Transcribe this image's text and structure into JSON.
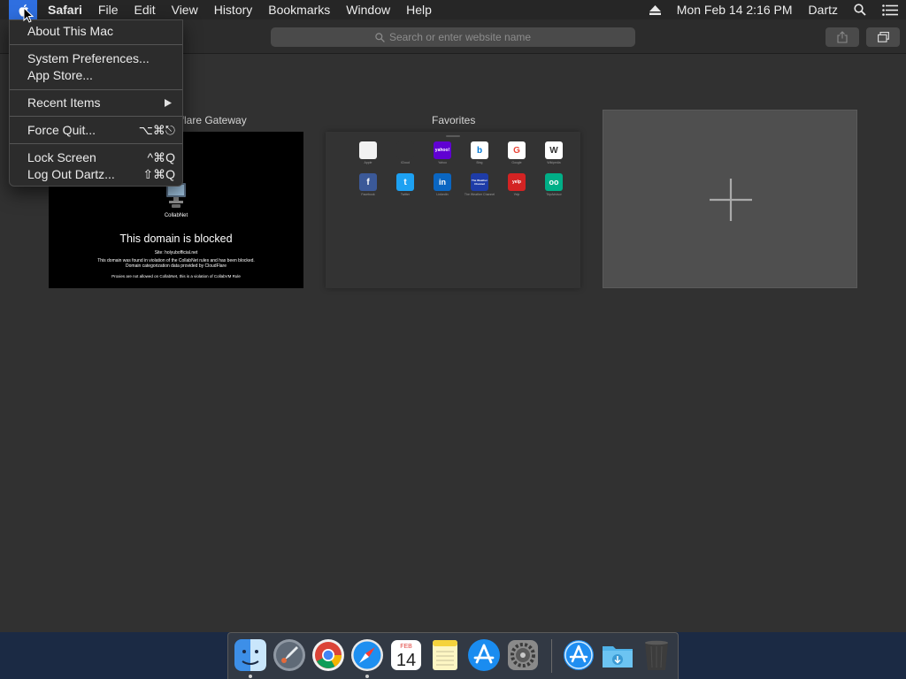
{
  "menubar": {
    "app_name": "Safari",
    "items": [
      "File",
      "Edit",
      "View",
      "History",
      "Bookmarks",
      "Window",
      "Help"
    ],
    "clock": "Mon Feb 14  2:16 PM",
    "user": "Dartz"
  },
  "toolbar": {
    "address_placeholder": "Search or enter website name"
  },
  "apple_menu": {
    "about": "About This Mac",
    "system_prefs": "System Preferences...",
    "app_store": "App Store...",
    "recent_items": "Recent Items",
    "force_quit": "Force Quit...",
    "force_quit_shortcut": "⌥⌘⎋",
    "lock_screen": "Lock Screen",
    "lock_screen_shortcut": "^⌘Q",
    "log_out": "Log Out Dartz...",
    "log_out_shortcut": "⇧⌘Q"
  },
  "tiles": {
    "gateway": {
      "title_visible": "lflare Gateway",
      "collabnet": "CollabNet",
      "heading": "This domain is blocked",
      "site": "Site: holyubofficial.net",
      "description": "This domain was found in violation of the CollabNet rules and has been blocked. Domain categorization data provided by CloudFlare",
      "footer": "Proxies are not allowed on CollabNet, this is a violation of CollabVM Rule"
    },
    "favorites": {
      "title": "Favorites",
      "items": [
        {
          "label": "Apple",
          "icon": "apple-icon",
          "bg": "#f2f2f2",
          "fg": "#555555",
          "glyph": ""
        },
        {
          "label": "iCloud",
          "icon": "apple-icon",
          "bg": "#333333",
          "fg": "#9a9a9a",
          "glyph": ""
        },
        {
          "label": "Yahoo",
          "icon": "yahoo-icon",
          "bg": "#6001d2",
          "fg": "#ffffff",
          "glyph": "yahoo!"
        },
        {
          "label": "Bing",
          "icon": "bing-icon",
          "bg": "#ffffff",
          "fg": "#0078d4",
          "glyph": "b"
        },
        {
          "label": "Google",
          "icon": "google-icon",
          "bg": "#ffffff",
          "fg": "#ea4335",
          "glyph": "G"
        },
        {
          "label": "Wikipedia",
          "icon": "wikipedia-icon",
          "bg": "#ffffff",
          "fg": "#333333",
          "glyph": "W"
        },
        {
          "label": "Facebook",
          "icon": "facebook-icon",
          "bg": "#3b5998",
          "fg": "#ffffff",
          "glyph": "f"
        },
        {
          "label": "Twitter",
          "icon": "twitter-icon",
          "bg": "#1da1f2",
          "fg": "#ffffff",
          "glyph": "t"
        },
        {
          "label": "LinkedIn",
          "icon": "linkedin-icon",
          "bg": "#0a66c2",
          "fg": "#ffffff",
          "glyph": "in"
        },
        {
          "label": "The Weather Channel",
          "icon": "weather-channel-icon",
          "bg": "#1e3ca8",
          "fg": "#ffffff",
          "glyph": "The Weather Channel"
        },
        {
          "label": "Yelp",
          "icon": "yelp-icon",
          "bg": "#d32323",
          "fg": "#ffffff",
          "glyph": "yelp"
        },
        {
          "label": "TripAdvisor",
          "icon": "tripadvisor-icon",
          "bg": "#00af87",
          "fg": "#ffffff",
          "glyph": "oo"
        }
      ]
    }
  },
  "dock": {
    "apps": [
      {
        "name": "finder",
        "running": true
      },
      {
        "name": "launchpad",
        "running": false
      },
      {
        "name": "chrome",
        "running": false
      },
      {
        "name": "safari",
        "running": true
      },
      {
        "name": "calendar",
        "running": false,
        "month": "FEB",
        "day": "14"
      },
      {
        "name": "notes",
        "running": false
      },
      {
        "name": "app-store",
        "running": false
      },
      {
        "name": "system-preferences",
        "running": false
      },
      {
        "name": "applications-folder",
        "running": false
      },
      {
        "name": "downloads-folder",
        "running": false
      },
      {
        "name": "trash",
        "running": false
      }
    ]
  }
}
